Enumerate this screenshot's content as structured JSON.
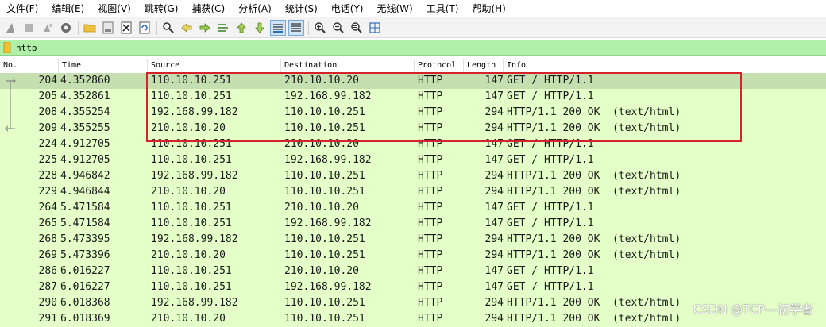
{
  "menu": [
    "文件(F)",
    "编辑(E)",
    "视图(V)",
    "跳转(G)",
    "捕获(C)",
    "分析(A)",
    "统计(S)",
    "电话(Y)",
    "无线(W)",
    "工具(T)",
    "帮助(H)"
  ],
  "toolbar": {
    "icons": [
      "shark-fin-icon",
      "stop-icon",
      "restart-icon",
      "options-gear-icon",
      "open-folder-icon",
      "save-file-icon",
      "close-file-icon",
      "reload-icon",
      "find-icon",
      "back-arrow-icon",
      "forward-arrow-icon",
      "goto-packet-icon",
      "first-packet-icon",
      "last-packet-icon",
      "autoscroll-icon",
      "colorize-icon",
      "zoom-in-icon",
      "zoom-out-icon",
      "zoom-normal-icon",
      "resize-columns-icon"
    ]
  },
  "filter": {
    "value": "http"
  },
  "columns": [
    "No.",
    "Time",
    "Source",
    "Destination",
    "Protocol",
    "Length",
    "Info"
  ],
  "packets": [
    {
      "no": "204",
      "time": "4.352860",
      "src": "110.10.10.251",
      "dst": "210.10.10.20",
      "proto": "HTTP",
      "len": "147",
      "info": "GET / HTTP/1.1",
      "selected": true,
      "marker": "out"
    },
    {
      "no": "205",
      "time": "4.352861",
      "src": "110.10.10.251",
      "dst": "192.168.99.182",
      "proto": "HTTP",
      "len": "147",
      "info": "GET / HTTP/1.1",
      "marker": "line"
    },
    {
      "no": "208",
      "time": "4.355254",
      "src": "192.168.99.182",
      "dst": "110.10.10.251",
      "proto": "HTTP",
      "len": "294",
      "info": "HTTP/1.1 200 OK  (text/html)",
      "marker": "line"
    },
    {
      "no": "209",
      "time": "4.355255",
      "src": "210.10.10.20",
      "dst": "110.10.10.251",
      "proto": "HTTP",
      "len": "294",
      "info": "HTTP/1.1 200 OK  (text/html)",
      "marker": "in"
    },
    {
      "no": "224",
      "time": "4.912705",
      "src": "110.10.10.251",
      "dst": "210.10.10.20",
      "proto": "HTTP",
      "len": "147",
      "info": "GET / HTTP/1.1"
    },
    {
      "no": "225",
      "time": "4.912705",
      "src": "110.10.10.251",
      "dst": "192.168.99.182",
      "proto": "HTTP",
      "len": "147",
      "info": "GET / HTTP/1.1"
    },
    {
      "no": "228",
      "time": "4.946842",
      "src": "192.168.99.182",
      "dst": "110.10.10.251",
      "proto": "HTTP",
      "len": "294",
      "info": "HTTP/1.1 200 OK  (text/html)"
    },
    {
      "no": "229",
      "time": "4.946844",
      "src": "210.10.10.20",
      "dst": "110.10.10.251",
      "proto": "HTTP",
      "len": "294",
      "info": "HTTP/1.1 200 OK  (text/html)"
    },
    {
      "no": "264",
      "time": "5.471584",
      "src": "110.10.10.251",
      "dst": "210.10.10.20",
      "proto": "HTTP",
      "len": "147",
      "info": "GET / HTTP/1.1"
    },
    {
      "no": "265",
      "time": "5.471584",
      "src": "110.10.10.251",
      "dst": "192.168.99.182",
      "proto": "HTTP",
      "len": "147",
      "info": "GET / HTTP/1.1"
    },
    {
      "no": "268",
      "time": "5.473395",
      "src": "192.168.99.182",
      "dst": "110.10.10.251",
      "proto": "HTTP",
      "len": "294",
      "info": "HTTP/1.1 200 OK  (text/html)"
    },
    {
      "no": "269",
      "time": "5.473396",
      "src": "210.10.10.20",
      "dst": "110.10.10.251",
      "proto": "HTTP",
      "len": "294",
      "info": "HTTP/1.1 200 OK  (text/html)"
    },
    {
      "no": "286",
      "time": "6.016227",
      "src": "110.10.10.251",
      "dst": "210.10.10.20",
      "proto": "HTTP",
      "len": "147",
      "info": "GET / HTTP/1.1"
    },
    {
      "no": "287",
      "time": "6.016227",
      "src": "110.10.10.251",
      "dst": "192.168.99.182",
      "proto": "HTTP",
      "len": "147",
      "info": "GET / HTTP/1.1"
    },
    {
      "no": "290",
      "time": "6.018368",
      "src": "192.168.99.182",
      "dst": "110.10.10.251",
      "proto": "HTTP",
      "len": "294",
      "info": "HTTP/1.1 200 OK  (text/html)"
    },
    {
      "no": "291",
      "time": "6.018369",
      "src": "210.10.10.20",
      "dst": "110.10.10.251",
      "proto": "HTTP",
      "len": "294",
      "info": "HTTP/1.1 200 OK  (text/html)"
    }
  ],
  "watermark": "CSDN @TCP---初学者",
  "colors": {
    "row": "#e4ffc7",
    "selected": "#c5dfb0",
    "filter": "#b0f0a8",
    "highlight": "#d6222a"
  }
}
